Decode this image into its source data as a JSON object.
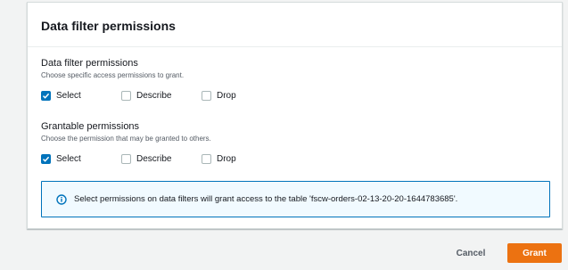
{
  "panel": {
    "title": "Data filter permissions"
  },
  "data_filter_permissions": {
    "label": "Data filter permissions",
    "description": "Choose specific access permissions to grant.",
    "options": [
      {
        "label": "Select",
        "checked": true
      },
      {
        "label": "Describe",
        "checked": false
      },
      {
        "label": "Drop",
        "checked": false
      }
    ]
  },
  "grantable_permissions": {
    "label": "Grantable permissions",
    "description": "Choose the permission that may be granted to others.",
    "options": [
      {
        "label": "Select",
        "checked": true
      },
      {
        "label": "Describe",
        "checked": false
      },
      {
        "label": "Drop",
        "checked": false
      }
    ]
  },
  "info_alert": {
    "icon": "info-icon",
    "text": "Select permissions on data filters will grant access to the table 'fscw-orders-02-13-20-20-1644783685'."
  },
  "footer": {
    "cancel_label": "Cancel",
    "grant_label": "Grant"
  },
  "colors": {
    "accent": "#0073bb",
    "primary_button": "#ec7211",
    "info_background": "#f1faff"
  }
}
